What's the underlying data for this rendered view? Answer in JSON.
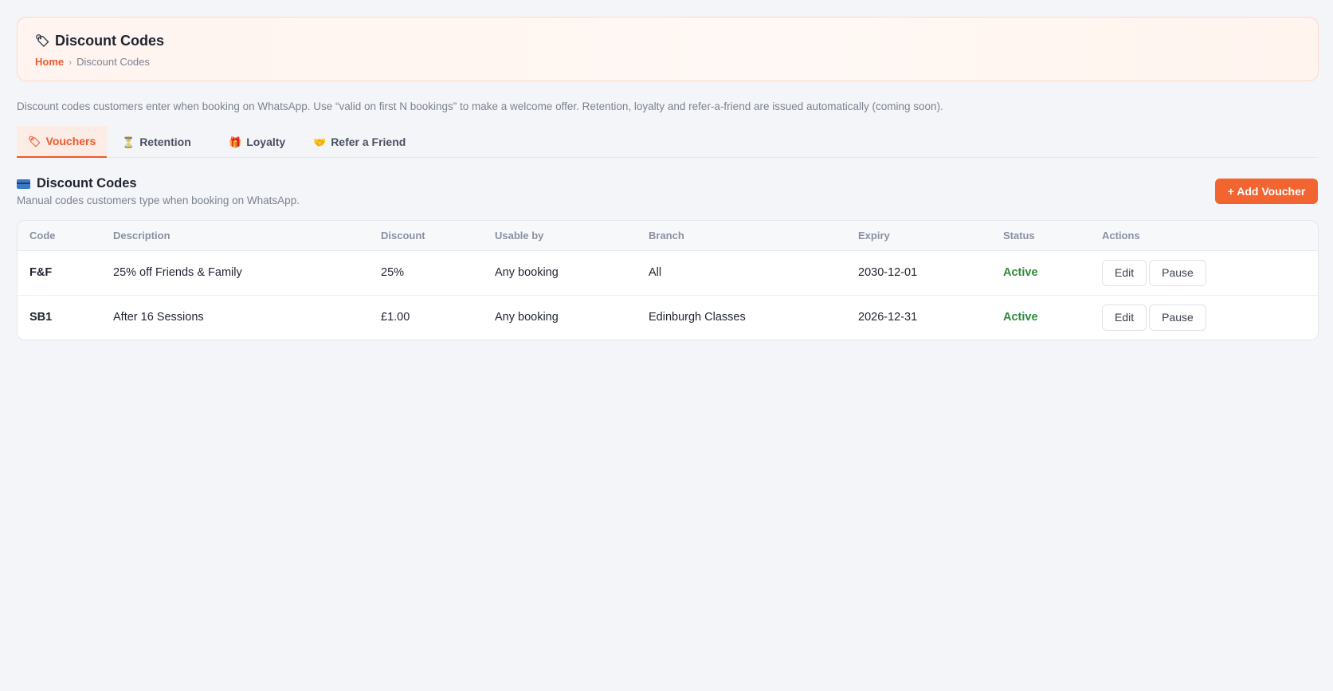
{
  "header": {
    "title": "Discount Codes",
    "title_icon": "tag-icon",
    "breadcrumb": {
      "home": "Home",
      "separator": "›",
      "current": "Discount Codes"
    }
  },
  "intro_text": "Discount codes customers enter when booking on WhatsApp. Use “valid on first N bookings” to make a welcome offer. Retention, loyalty and refer-a-friend are issued automatically (coming soon).",
  "tabs": [
    {
      "label": "Vouchers",
      "icon": "tag-icon",
      "active": true
    },
    {
      "label": "Retention",
      "icon": "hourglass-icon",
      "active": false
    },
    {
      "label": "Loyalty",
      "icon": "gift-icon",
      "active": false
    },
    {
      "label": "Refer a Friend",
      "icon": "handshake-icon",
      "active": false
    }
  ],
  "section": {
    "title": "Discount Codes",
    "icon": "credit-card-icon",
    "subtitle": "Manual codes customers type when booking on WhatsApp.",
    "add_button": "+ Add Voucher"
  },
  "table": {
    "columns": [
      "Code",
      "Description",
      "Discount",
      "Usable by",
      "Branch",
      "Expiry",
      "Status",
      "Actions"
    ],
    "rows": [
      {
        "code": "F&F",
        "description": "25% off Friends & Family",
        "discount": "25%",
        "usable_by": "Any booking",
        "branch": "All",
        "expiry": "2030-12-01",
        "status": "Active",
        "edit": "Edit",
        "pause": "Pause"
      },
      {
        "code": "SB1",
        "description": "After 16 Sessions",
        "discount": "£1.00",
        "usable_by": "Any booking",
        "branch": "Edinburgh Classes",
        "expiry": "2026-12-31",
        "status": "Active",
        "edit": "Edit",
        "pause": "Pause"
      }
    ]
  },
  "colors": {
    "accent": "#f26430",
    "active_status": "#2e8b3a",
    "background": "#f4f5f8"
  }
}
